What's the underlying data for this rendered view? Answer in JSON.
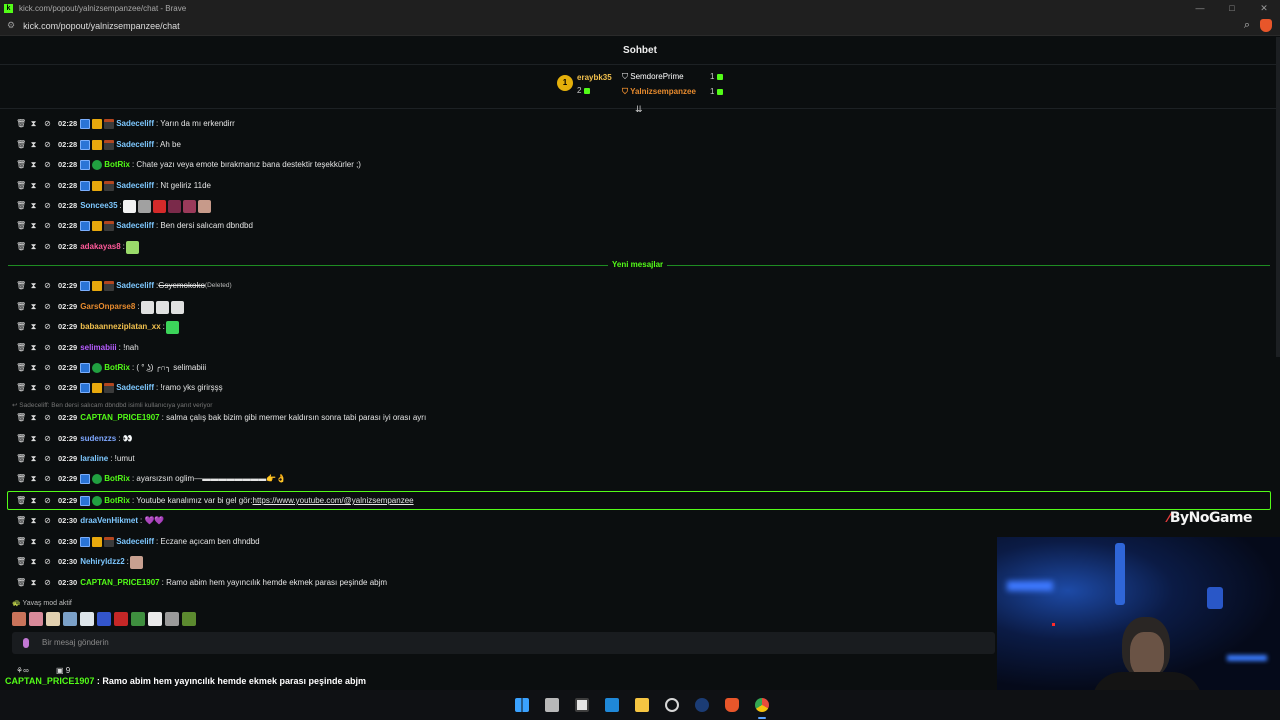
{
  "browser": {
    "tab_title": "kick.com/popout/yalnizsempanzee/chat - Brave",
    "address": "kick.com/popout/yalnizsempanzee/chat",
    "controls": [
      "—",
      "□",
      "✕"
    ]
  },
  "chat": {
    "header_title": "Sohbet",
    "leaderboard": {
      "rank_badge": "1",
      "first": {
        "name": "eraybk35",
        "count": "2"
      },
      "second": {
        "name": "SemdorePrime",
        "count": "1"
      },
      "third": {
        "name": "Yalnizsempanzee",
        "count": "1"
      }
    },
    "new_messages_label": "Yeni mesajlar",
    "reply_context": "Sadeceliff: Ben dersi salıcam dbndbd isimli kullanıcıya yanıt veriyor",
    "messages": [
      {
        "time": "02:28",
        "user": "Sadeceliff",
        "text": ": Yarın da mı erkendirr"
      },
      {
        "time": "02:28",
        "user": "Sadeceliff",
        "text": ": Ah be"
      },
      {
        "time": "02:28",
        "user": "BotRix",
        "text": ": Chate yazı veya emote bırakmanız bana destektir teşekkürler ;)"
      },
      {
        "time": "02:28",
        "user": "Sadeceliff",
        "text": ": Nt geliriz 11de"
      },
      {
        "time": "02:28",
        "user": "Soncee35",
        "text": ": "
      },
      {
        "time": "02:28",
        "user": "Sadeceliff",
        "text": ": Ben dersi salıcam dbndbd"
      },
      {
        "time": "02:28",
        "user": "adakayas8",
        "text": ": "
      },
      {
        "time": "02:29",
        "user": "Sadeceliff",
        "text": ": ",
        "deleted_text": "Gsyemokoko",
        "deleted_tag": "(Deleted)"
      },
      {
        "time": "02:29",
        "user": "GarsOnparse8",
        "text": ": "
      },
      {
        "time": "02:29",
        "user": "babaanneziplatan_xx",
        "text": ": "
      },
      {
        "time": "02:29",
        "user": "selimabiii",
        "text": ": !nah"
      },
      {
        "time": "02:29",
        "user": "BotRix",
        "text": ": ( ° ͜ʖ) ╭∩╮ selimabiii"
      },
      {
        "time": "02:29",
        "user": "Sadeceliff",
        "text": ": !ramo yks girirşşş"
      },
      {
        "time": "02:29",
        "user": "CAPTAN_PRICE1907",
        "text": ": salma çalış bak bizim gibi mermer kaldırsın sonra tabi parası iyi orası ayrı"
      },
      {
        "time": "02:29",
        "user": "sudenzzs",
        "text": ": 👀"
      },
      {
        "time": "02:29",
        "user": "laraline",
        "text": ": !umut"
      },
      {
        "time": "02:29",
        "user": "BotRix",
        "text": ": ayarsızsın oglim—▬▬▬▬▬▬▬▬👉👌"
      },
      {
        "time": "02:29",
        "user": "BotRix",
        "text": ": Youtube kanalımız var bi gel gör: ",
        "link": "https://www.youtube.com/@yalnizsempanzee"
      },
      {
        "time": "02:30",
        "user": "draaVenHikmet",
        "text": ": 💜💜"
      },
      {
        "time": "02:30",
        "user": "Sadeceliff",
        "text": ": Eczane açıcam ben dhndbd"
      },
      {
        "time": "02:30",
        "user": "Nehiryldzz2",
        "text": ": "
      },
      {
        "time": "02:30",
        "user": "CAPTAN_PRICE1907",
        "text": ": Ramo abim hem yayıncılık hemde ekmek parası peşinde abjm"
      }
    ],
    "slow_mode": "Yavaş mod aktif",
    "input_placeholder": "Bir mesaj gönderin"
  },
  "overlay": {
    "ticker_icons": "⚘∞",
    "ticker_count": "9",
    "ticker_user": "CAPTAN_PRICE1907",
    "ticker_text": " : Ramo abim hem yayıncılık hemde ekmek parası peşinde abjm",
    "sponsor": "ByNoGame"
  },
  "colors": {
    "kick_green": "#53fc18",
    "user_sadeceliff": "#7ec8ff",
    "user_botrix": "#53fc18",
    "user_soncee": "#7ec8ff",
    "user_adakaya": "#ff5a9a",
    "user_gars": "#e88b2e",
    "user_babaanne": "#f2c14e",
    "user_selim": "#b75cff",
    "user_captan": "#53fc18",
    "user_sudenzzs": "#7ea7ff",
    "user_laraline": "#7ec8ff",
    "user_draa": "#7ec8ff",
    "user_nehir": "#7ec8ff"
  }
}
